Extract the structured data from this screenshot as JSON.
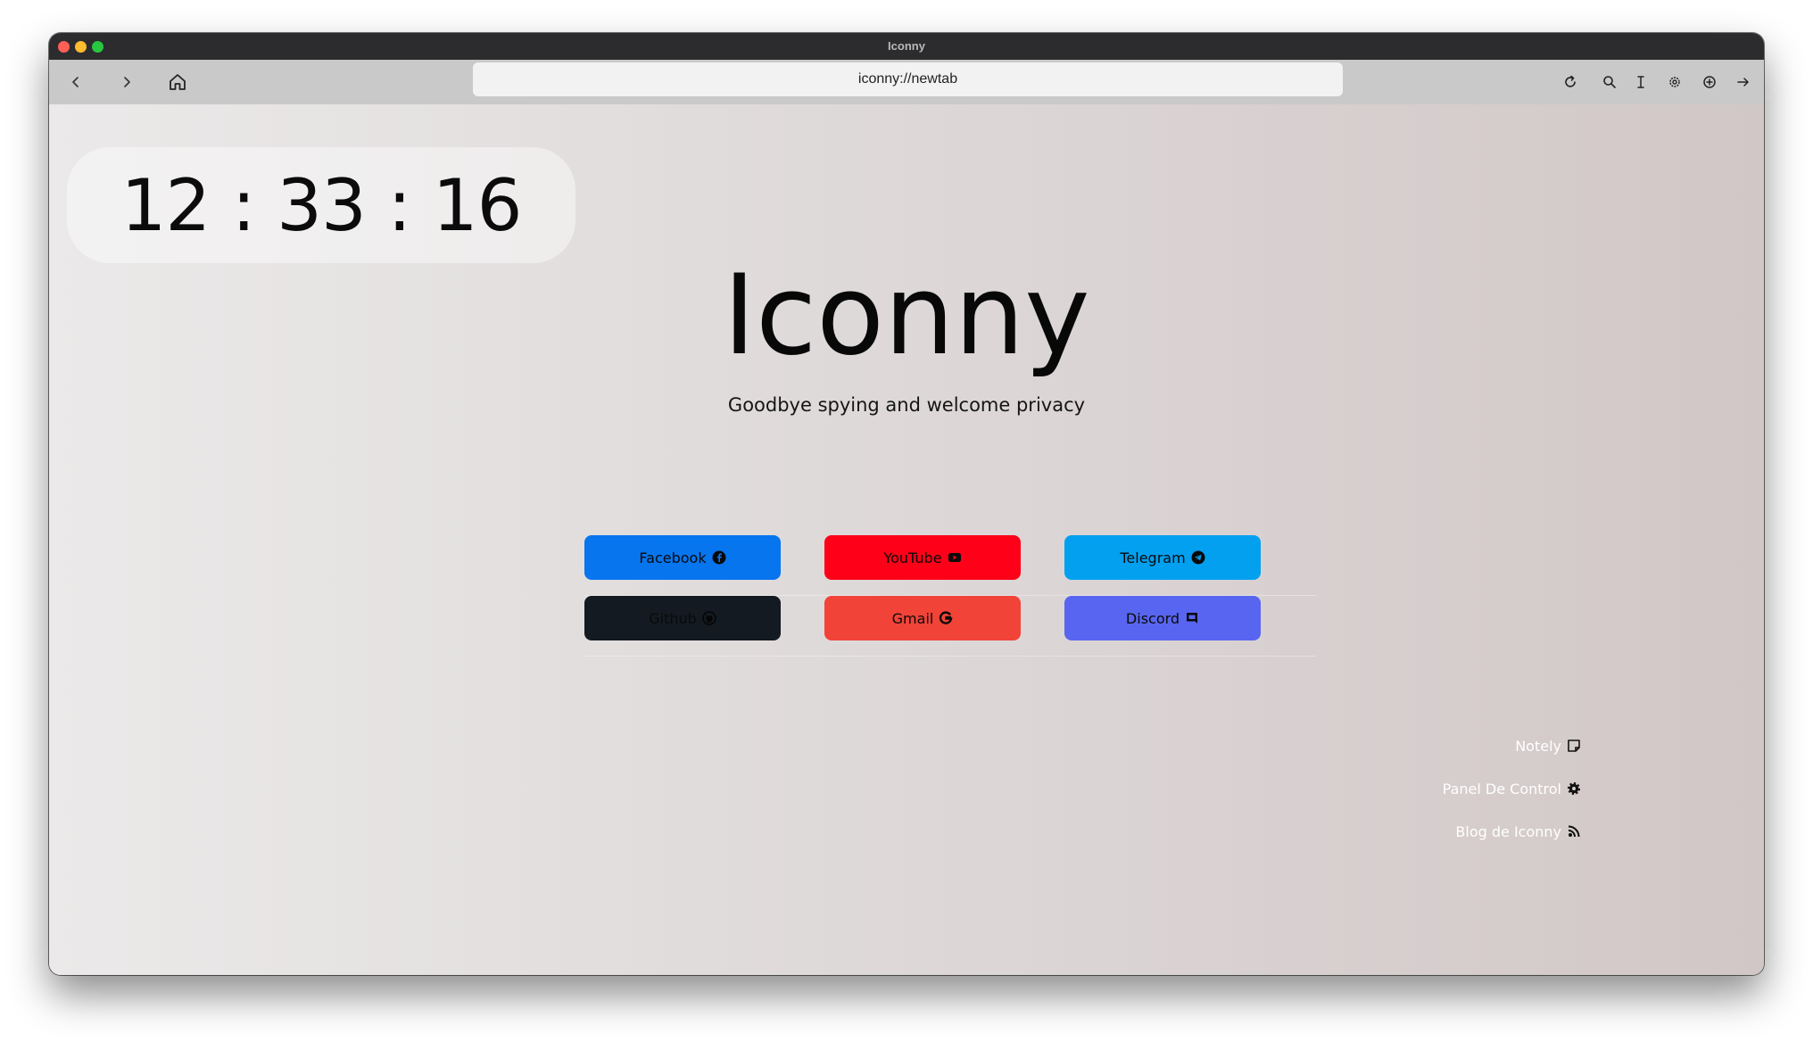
{
  "window": {
    "title": "Iconny"
  },
  "toolbar": {
    "back_icon": "chevron-left-icon",
    "forward_icon": "chevron-right-icon",
    "home_icon": "home-icon",
    "url": "iconny://newtab",
    "right_icons": [
      "reload-icon",
      "search-icon",
      "text-cursor-icon",
      "gear-icon",
      "add-circle-icon",
      "arrow-right-icon"
    ]
  },
  "page": {
    "clock": "12 : 33 : 16",
    "brand": "Iconny",
    "tagline": "Goodbye spying and welcome privacy",
    "shortcuts": [
      {
        "label": "Facebook",
        "icon": "facebook-icon",
        "color": "#0775ee"
      },
      {
        "label": "YouTube",
        "icon": "youtube-icon",
        "color": "#fe0018"
      },
      {
        "label": "Telegram",
        "icon": "telegram-icon",
        "color": "#03a0f0"
      },
      {
        "label": "Github",
        "icon": "github-icon",
        "color": "#131a21"
      },
      {
        "label": "Gmail",
        "icon": "google-icon",
        "color": "#f24338"
      },
      {
        "label": "Discord",
        "icon": "discord-icon",
        "color": "#5865f0"
      }
    ],
    "side_links": [
      {
        "label": "Notely",
        "icon": "note-icon"
      },
      {
        "label": "Panel De Control",
        "icon": "gear-icon"
      },
      {
        "label": "Blog de Iconny",
        "icon": "rss-icon"
      }
    ]
  }
}
